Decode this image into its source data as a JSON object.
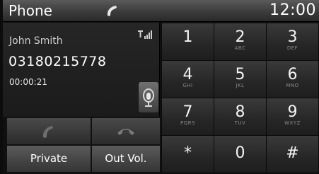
{
  "status_bar": {
    "app_title": "Phone",
    "time": "12:00"
  },
  "call": {
    "contact_name": "John Smith",
    "number": "03180215778",
    "duration": "00:00:21"
  },
  "buttons": {
    "private": "Private",
    "out_vol": "Out Vol."
  },
  "keypad": [
    {
      "digit": "1",
      "letters": ""
    },
    {
      "digit": "2",
      "letters": "ABC"
    },
    {
      "digit": "3",
      "letters": "DEF"
    },
    {
      "digit": "4",
      "letters": "GHI"
    },
    {
      "digit": "5",
      "letters": "JKL"
    },
    {
      "digit": "6",
      "letters": "MNO"
    },
    {
      "digit": "7",
      "letters": "PQRS"
    },
    {
      "digit": "8",
      "letters": "TUV"
    },
    {
      "digit": "9",
      "letters": "WXYZ"
    },
    {
      "digit": "*",
      "letters": ""
    },
    {
      "digit": "0",
      "letters": ""
    },
    {
      "digit": "#",
      "letters": ""
    }
  ],
  "icons": {
    "status_handset": "handset-icon",
    "signal": "signal-strength-icon",
    "voice": "voice-recognition-icon",
    "accept_call": "accept-call-icon",
    "end_call": "end-call-icon"
  }
}
